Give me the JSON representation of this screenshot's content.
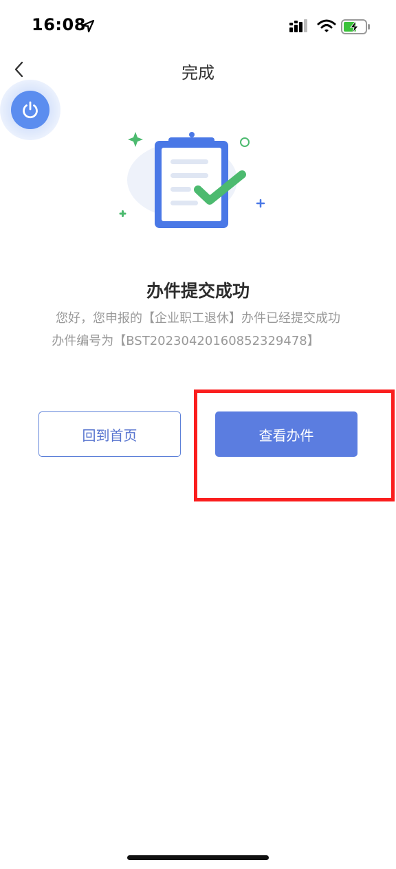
{
  "status_bar": {
    "time": "16:08",
    "icons": [
      "location-arrow-icon",
      "signal-icon",
      "wifi-icon",
      "battery-charging-icon"
    ]
  },
  "nav": {
    "title": "完成",
    "back_icon": "chevron-left-icon"
  },
  "floating_button": {
    "icon": "power-icon",
    "color": "#5b8def"
  },
  "result": {
    "illustration_icon": "clipboard-check-icon",
    "title": "办件提交成功",
    "message": "您好，您申报的【企业职工退休】办件已经提交成功",
    "case_number": "办件编号为【BST2023042016085232947​8】"
  },
  "actions": {
    "home_label": "回到首页",
    "view_case_label": "查看办件"
  },
  "colors": {
    "primary": "#5b7de0",
    "highlight": "#fa1e1e",
    "success_green": "#4cba6f",
    "text_muted": "#999999"
  }
}
